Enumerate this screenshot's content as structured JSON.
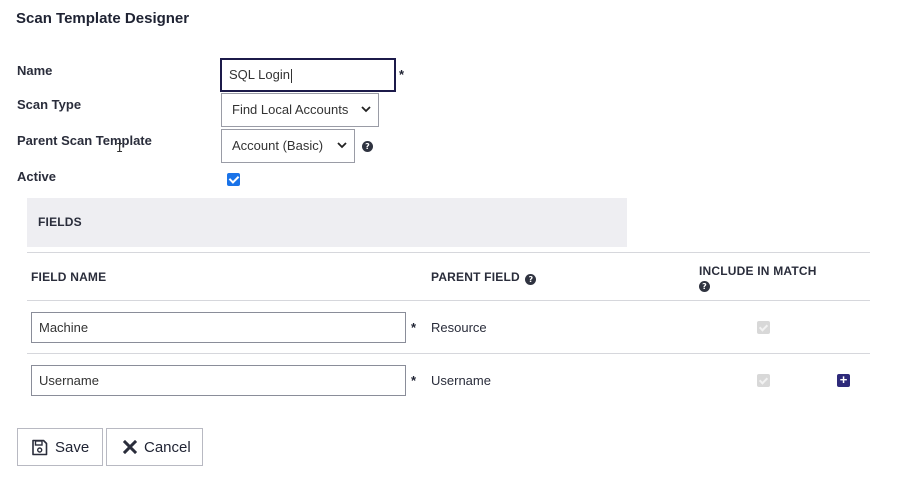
{
  "page": {
    "title": "Scan Template Designer"
  },
  "form": {
    "name_label": "Name",
    "name_value": "SQL Login",
    "required_mark": "*",
    "scan_type_label": "Scan Type",
    "scan_type_value": "Find Local Accounts",
    "parent_template_label": "Parent Scan Template",
    "parent_template_value": "Account (Basic)",
    "active_label": "Active",
    "active_checked": true
  },
  "fields_section": {
    "title": "FIELDS",
    "columns": {
      "field_name": "FIELD NAME",
      "parent_field": "PARENT FIELD",
      "include_in_match": "INCLUDE IN MATCH"
    },
    "rows": [
      {
        "field_name": "Machine",
        "parent_field": "Resource",
        "include_in_match": true
      },
      {
        "field_name": "Username",
        "parent_field": "Username",
        "include_in_match": true
      }
    ]
  },
  "actions": {
    "save_label": "Save",
    "cancel_label": "Cancel"
  },
  "icons": {
    "help": "question-circle-icon",
    "save": "floppy-disk-icon",
    "cancel": "x-icon",
    "add": "plus-square-icon",
    "dropdown": "chevron-down-icon"
  },
  "colors": {
    "text": "#1f2333",
    "focus_border": "#1c1a4a",
    "checkbox_blue": "#1a73e8",
    "add_button": "#2e2a7a",
    "section_bg": "#eeeef2"
  }
}
